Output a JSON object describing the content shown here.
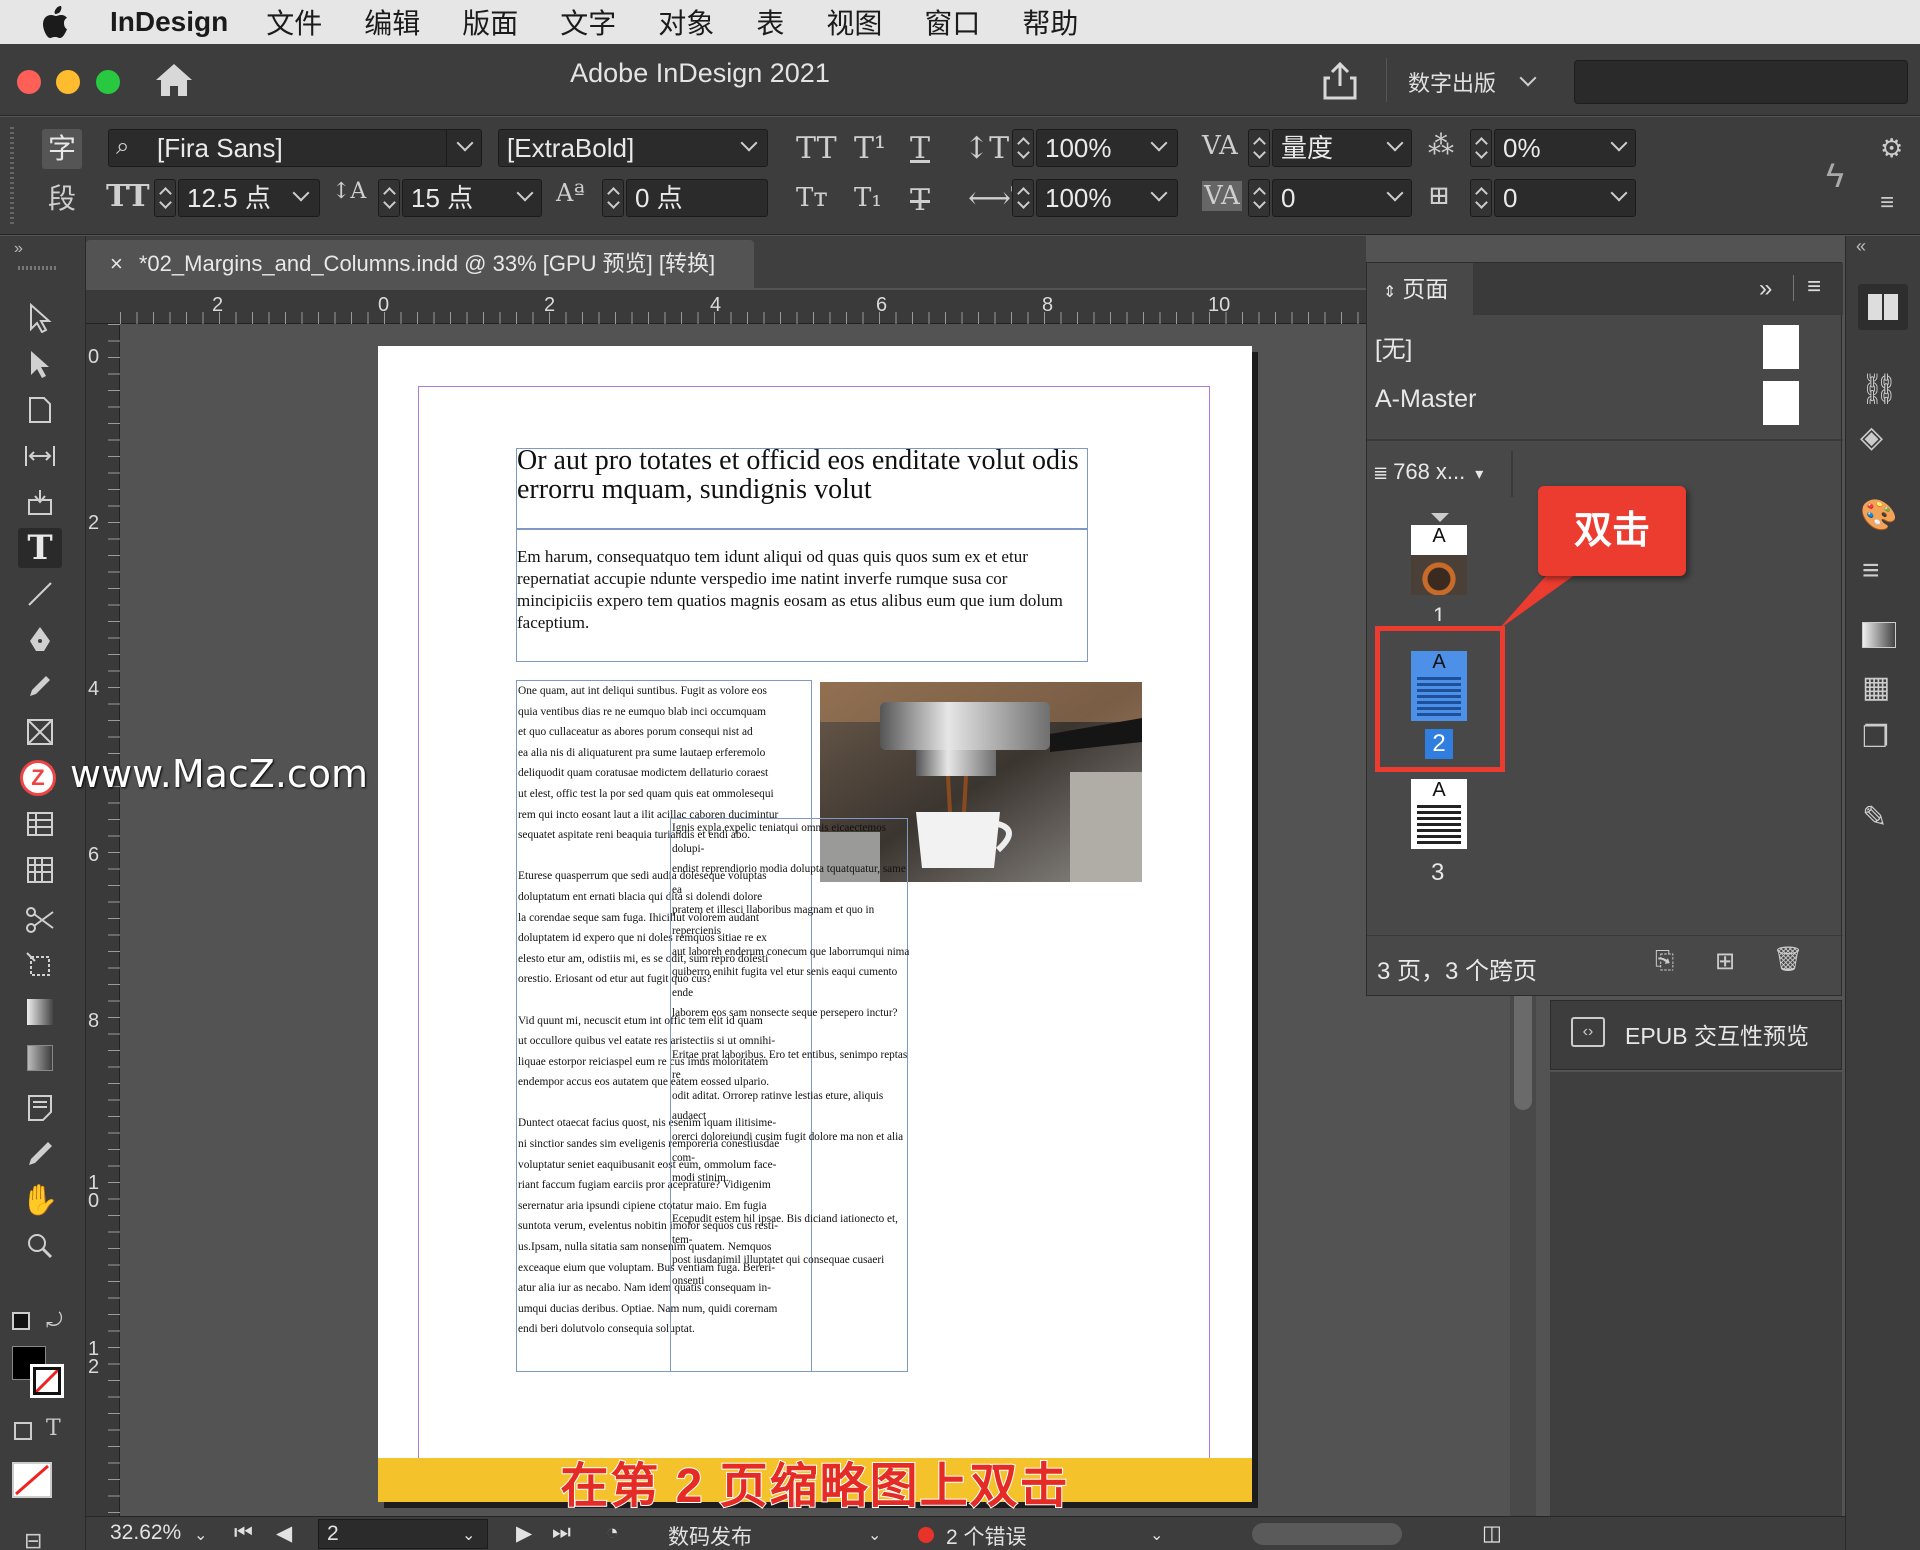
{
  "menubar": {
    "app_name": "InDesign",
    "items": [
      "文件",
      "编辑",
      "版面",
      "文字",
      "对象",
      "表",
      "视图",
      "窗口",
      "帮助"
    ]
  },
  "titlebar": {
    "title": "Adobe InDesign 2021",
    "workspace": "数字出版"
  },
  "control": {
    "font_family": "[Fira Sans]",
    "font_style": "[ExtraBold]",
    "font_size": "12.5 点",
    "leading": "15 点",
    "baseline_shift": "0 点",
    "vertical_scale": "100%",
    "horizontal_scale": "100%",
    "kerning": "量度",
    "tracking": "0",
    "tsume": "0%",
    "grid": "0",
    "char_label": "字",
    "para_label": "段"
  },
  "document": {
    "tab_title": "*02_Margins_and_Columns.indd @ 33% [GPU 预览] [转换]",
    "close_symbol": "×"
  },
  "ruler": {
    "h_labels": [
      "2",
      "0",
      "2",
      "4",
      "6",
      "8",
      "10"
    ],
    "v_labels": [
      "0",
      "2",
      "4",
      "6",
      "8",
      "1\n0",
      "1\n2"
    ]
  },
  "page_content": {
    "headline": "Or aut pro totates et officid eos enditate volut odis errorru mquam, sundignis volut",
    "intro": "Em harum, consequatquo tem idunt aliqui od quas quis quos sum ex et etur repernatiat accupie ndunte verspedio ime natint inverfe rumque susa cor mincipiciis expero tem quatios magnis eosam as etus alibus eum que ium dolum faceptium.",
    "col1": "One quam, aut int deliqui suntibus. Fugit as volore eos\nquia ventibus dias re ne eumquo blab inci occumquam\net quo cullaceatur as abores porum consequi nist ad\nea alia nis di aliquaturent pra sume lautaep erferemolo\ndeliquodit quam coratusae modictem dellaturio coraest\nut elest, offic test la por sed quam quis eat ommolesequi\nrem qui incto eosant laut a ilit acillac caboren ducimintur\nsequatet aspitate reni beaquia turiandis et endi abo.\n\nEturese quasperrum que sedi audia doleseque voluptas\ndoluptatum ent ernati blacia qui dita si dolendi dolore\nla corendae seque sam fuga. Ihicillut volorem audant\ndoluptatem id expero que ni doles remquos sitiae re ex\nelesto etur am, odistiis mi, es se odit, sum repro dolesti\norestio. Eriosant od etur aut fugit quo cus?\n\nVid quunt mi, necuscit etum int offic tem elit id quam\nut occullore quibus vel eatate res aristectiis si ut omnihi-\nliquae estorpor reiciaspel eum re cus imus moloritatem\nendempor accus eos autatem que eatem eossed ulpario.\n\nDuntect otaecat facius quost, nis esenim iquam ilitisime-\nni sinctior sandes sim eveligenis remporeria conestiusdae\nvoluptatur seniet eaquibusanit eost eum, ommolum face-\nriant faccum fugiam earciis pror aceprature? Vidigenim\nserernatur aria ipsundi cipiene ctotatur maio. Em fugia\nsuntota verum, evelentus nobitin imolor sequos cus resti-\nus.Ipsam, nulla sitatia sam nonsenim quatem. Nemquos\nexceaque eium que voluptam. Bus ventiam fuga. Bereri-\natur alia iur as necabo. Nam idem quatis consequam in-\numqui ducias deribus. Optiae. Nam num, quidi corernam\nendi beri dolutvolo consequia soluptat.",
    "col2": "Ignis expla expelic teniatqui omnis eicaectemos dolupi-\nendist reprendiorio modia dolupta tquatquatur, same ea\npratem et illesci llaboribus magnam et quo in repercienis\naut laboreh enderum conecum que laborrumqui nima\nquiberro enihit fugita vel etur senis eaqui cumento ende\nlaborem eos sam nonsecte seque persepero inctur?\n\nEritae prat laboribus. Ero tet entibus, senimpo reptas re\nodit aditat. Orrorep ratinve lestias eture, aliquis audaect\norerci doloreiundi cusim fugit dolore ma non et alia com-\nmodi stinim.\n\nEcepudit estem hil ipsae. Bis diciand iationecto et, tem-\npost iusdanimil illuptatet qui consequae cusaeri onsenti"
  },
  "overlay": {
    "watermark": "www.MacZ.com",
    "caption": "在第 2 页缩略图上双击",
    "callout": "双击"
  },
  "pages_panel": {
    "tab_label": "页面",
    "masters": [
      "[无]",
      "A-Master"
    ],
    "size_label": "768 x...",
    "pages": [
      {
        "number": "1",
        "master": "A"
      },
      {
        "number": "2",
        "master": "A",
        "selected": true
      },
      {
        "number": "3",
        "master": "A"
      }
    ],
    "summary": "3 页，3 个跨页"
  },
  "epub_panel": {
    "label": "EPUB 交互性预览"
  },
  "status": {
    "zoom": "32.62%",
    "page": "2",
    "preflight_profile": "数码发布",
    "errors": "2 个错误"
  },
  "colors": {
    "accent_selected": "#2f7ee0",
    "annotation_red": "#ec3b2f",
    "caption_bar": "#f4c22a",
    "margin_guide": "#b27ad8",
    "frame_edge": "#7f98c4"
  }
}
